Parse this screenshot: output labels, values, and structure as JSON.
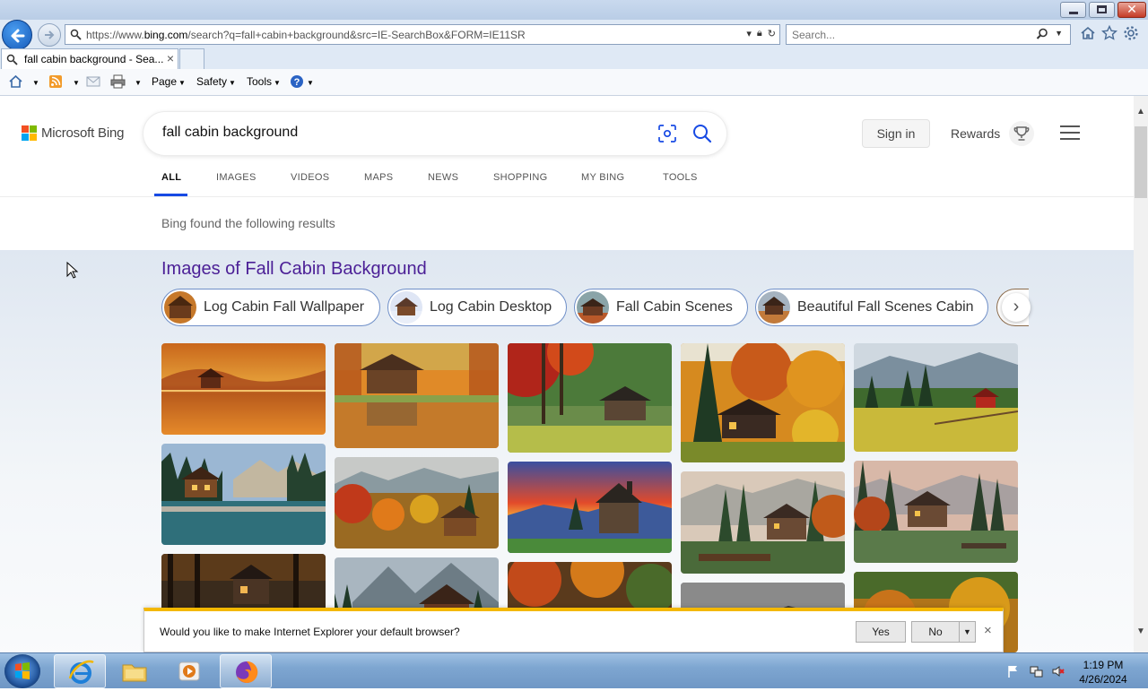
{
  "browser": {
    "url_prefix": "https://www.",
    "url_domain": "bing.com",
    "url_rest": "/search?q=fall+cabin+background&src=IE-SearchBox&FORM=IE11SR",
    "search_placeholder": "Search...",
    "tab_title": "fall cabin background - Sea...",
    "commands": {
      "page": "Page",
      "safety": "Safety",
      "tools": "Tools"
    }
  },
  "bing": {
    "logo_text": "Microsoft Bing",
    "query": "fall cabin background",
    "sign_in": "Sign in",
    "rewards": "Rewards",
    "scopes": [
      "ALL",
      "IMAGES",
      "VIDEOS",
      "MAPS",
      "NEWS",
      "SHOPPING",
      "MY BING",
      "TOOLS"
    ],
    "results_note": "Bing found the following results",
    "images_title": "Images of Fall Cabin Background",
    "chips": [
      "Log Cabin Fall Wallpaper",
      "Log Cabin Desktop",
      "Fall Cabin Scenes",
      "Beautiful Fall Scenes Cabin"
    ]
  },
  "notification": {
    "message": "Would you like to make Internet Explorer your default browser?",
    "yes": "Yes",
    "no": "No"
  },
  "taskbar": {
    "time": "1:19 PM",
    "date": "4/26/2024"
  },
  "colors": {
    "accent": "#174ae4",
    "images_title": "#4b1f96",
    "notify_bar": "#f4b800"
  }
}
